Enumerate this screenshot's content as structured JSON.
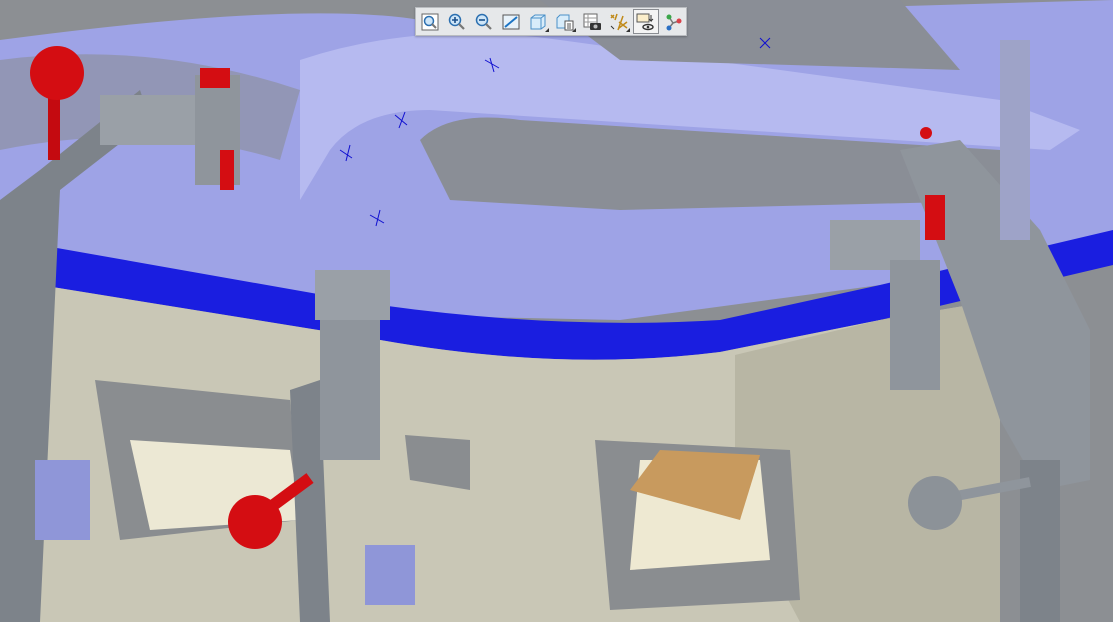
{
  "toolbar": {
    "buttons": [
      {
        "name": "refit",
        "icon": "zoom-fit-icon",
        "active": false,
        "flyout": false
      },
      {
        "name": "zoom-in",
        "icon": "zoom-in-icon",
        "active": false,
        "flyout": false
      },
      {
        "name": "zoom-out",
        "icon": "zoom-out-icon",
        "active": false,
        "flyout": false
      },
      {
        "name": "repaint",
        "icon": "repaint-icon",
        "active": false,
        "flyout": false
      },
      {
        "name": "display-style",
        "icon": "shaded-cube-icon",
        "active": false,
        "flyout": true
      },
      {
        "name": "saved-orientations",
        "icon": "saved-views-icon",
        "active": false,
        "flyout": true
      },
      {
        "name": "view-manager",
        "icon": "view-manager-camera-icon",
        "active": false,
        "flyout": false
      },
      {
        "name": "datum-display",
        "icon": "datum-display-icon",
        "active": false,
        "flyout": true
      },
      {
        "name": "annotation-display",
        "icon": "annotation-display-icon",
        "active": true,
        "flyout": false
      },
      {
        "name": "spin-center",
        "icon": "spin-center-icon",
        "active": false,
        "flyout": false
      }
    ]
  },
  "colors": {
    "background": "#8c8f93",
    "panel": "#9ea3e6",
    "flange": "#1a1ee0",
    "fixture_base": "#c9c7b6",
    "clamp": "#8f959c",
    "handle": "#d40d12",
    "active_button": "#f4f4f4"
  }
}
